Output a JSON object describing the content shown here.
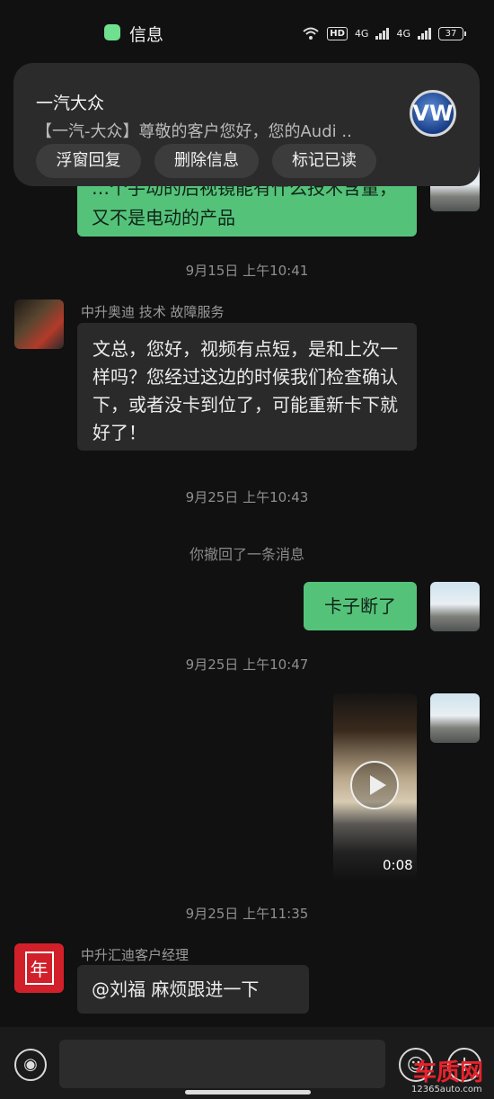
{
  "status_bar": {
    "app_name": "信息",
    "hd": "HD",
    "net1": "4G",
    "net2": "4G",
    "battery": "37"
  },
  "notification": {
    "title": "一汽大众",
    "body": "【一汽-大众】尊敬的客户您好，您的Audi ..",
    "logo": "VW",
    "buttons": [
      "浮窗回复",
      "删除信息",
      "标记已读"
    ]
  },
  "chat": {
    "partial_message": "…个手动的后视镜能有什么技术含量，又不是电动的产品",
    "time1": "9月15日 上午10:41",
    "sender1": "中升奥迪 技术 故障服务",
    "msg1": "文总，您好，视频有点短，是和上次一样吗？您经过这边的时候我们检查确认下，或者没卡到位了，可能重新卡下就好了！",
    "time2": "9月25日 上午10:43",
    "recall": "你撤回了一条消息",
    "msg2": "卡子断了",
    "time3": "9月25日 上午10:47",
    "video_duration": "0:08",
    "time4": "9月25日 上午11:35",
    "sender2": "中升汇迪客户经理",
    "msg3": "@刘福  麻烦跟进一下",
    "avatar_red_text": "年"
  },
  "input": {
    "placeholder": ""
  },
  "watermark": {
    "logo": "车质网",
    "url": "12365auto.com"
  },
  "colors": {
    "green_bubble": "#55c27a",
    "dark_bubble": "#2a2a2b",
    "background": "#111111"
  },
  "icons": [
    "message-app-icon",
    "wifi-icon",
    "battery-icon",
    "vw-logo",
    "play-icon",
    "voice-icon",
    "emoji-icon",
    "plus-icon"
  ]
}
